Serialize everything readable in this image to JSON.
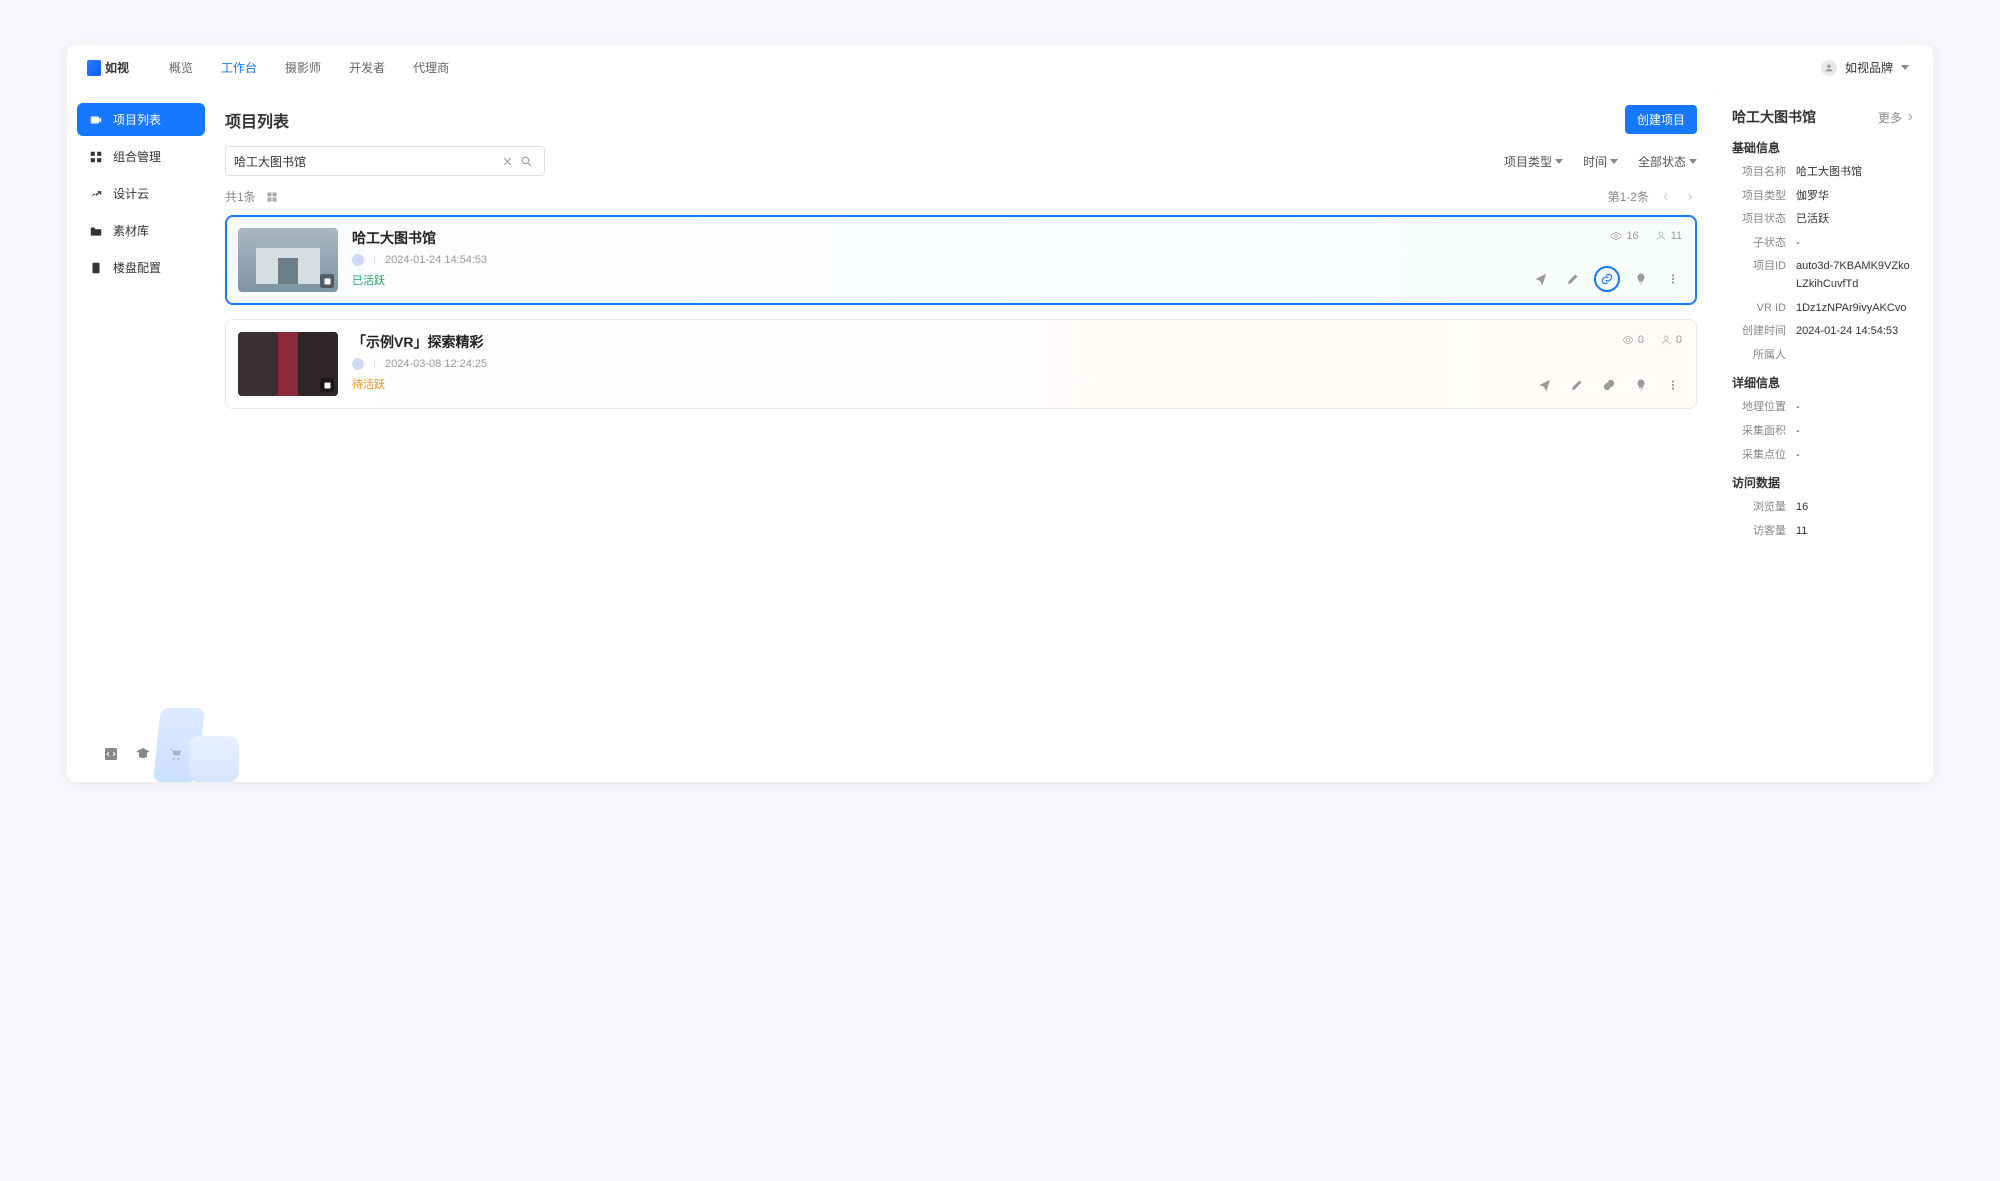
{
  "header": {
    "brand": "如视",
    "nav": [
      "概览",
      "工作台",
      "摄影师",
      "开发者",
      "代理商"
    ],
    "nav_active_index": 1,
    "user_label": "如视品牌"
  },
  "sidebar": {
    "items": [
      {
        "label": "项目列表",
        "icon": "video"
      },
      {
        "label": "组合管理",
        "icon": "modules"
      },
      {
        "label": "设计云",
        "icon": "design"
      },
      {
        "label": "素材库",
        "icon": "folder"
      },
      {
        "label": "楼盘配置",
        "icon": "building"
      }
    ],
    "active_index": 0
  },
  "main": {
    "title": "项目列表",
    "create_button": "创建项目",
    "search_value": "哈工大图书馆",
    "filters": {
      "type": "项目类型",
      "time": "时间",
      "status": "全部状态"
    },
    "count_label": "共1条",
    "pager_label": "第1-2条"
  },
  "projects": [
    {
      "title": "哈工大图书馆",
      "timestamp": "2024-01-24 14:54:53",
      "status_label": "已活跃",
      "status": "active",
      "views": "16",
      "visitors": "11",
      "selected": true
    },
    {
      "title": "「示例VR」探索精彩",
      "timestamp": "2024-03-08 12:24:25",
      "status_label": "待活跃",
      "status": "pending",
      "views": "0",
      "visitors": "0",
      "selected": false
    }
  ],
  "details": {
    "title": "哈工大图书馆",
    "more_label": "更多",
    "sections": {
      "basic": {
        "title": "基础信息",
        "rows": [
          {
            "k": "项目名称",
            "v": "哈工大图书馆"
          },
          {
            "k": "项目类型",
            "v": "伽罗华"
          },
          {
            "k": "项目状态",
            "v": "已活跃"
          },
          {
            "k": "子状态",
            "v": "-"
          },
          {
            "k": "项目ID",
            "v": "auto3d-7KBAMK9VZkoLZkihCuvfTd"
          },
          {
            "k": "VR ID",
            "v": "1Dz1zNPAr9ivyAKCvo"
          },
          {
            "k": "创建时间",
            "v": "2024-01-24 14:54:53"
          },
          {
            "k": "所属人",
            "v": ""
          }
        ]
      },
      "detail": {
        "title": "详细信息",
        "rows": [
          {
            "k": "地理位置",
            "v": "-"
          },
          {
            "k": "采集面积",
            "v": "-"
          },
          {
            "k": "采集点位",
            "v": "-"
          }
        ]
      },
      "visits": {
        "title": "访问数据",
        "rows": [
          {
            "k": "浏览量",
            "v": "16"
          },
          {
            "k": "访客量",
            "v": "11"
          }
        ]
      }
    }
  }
}
